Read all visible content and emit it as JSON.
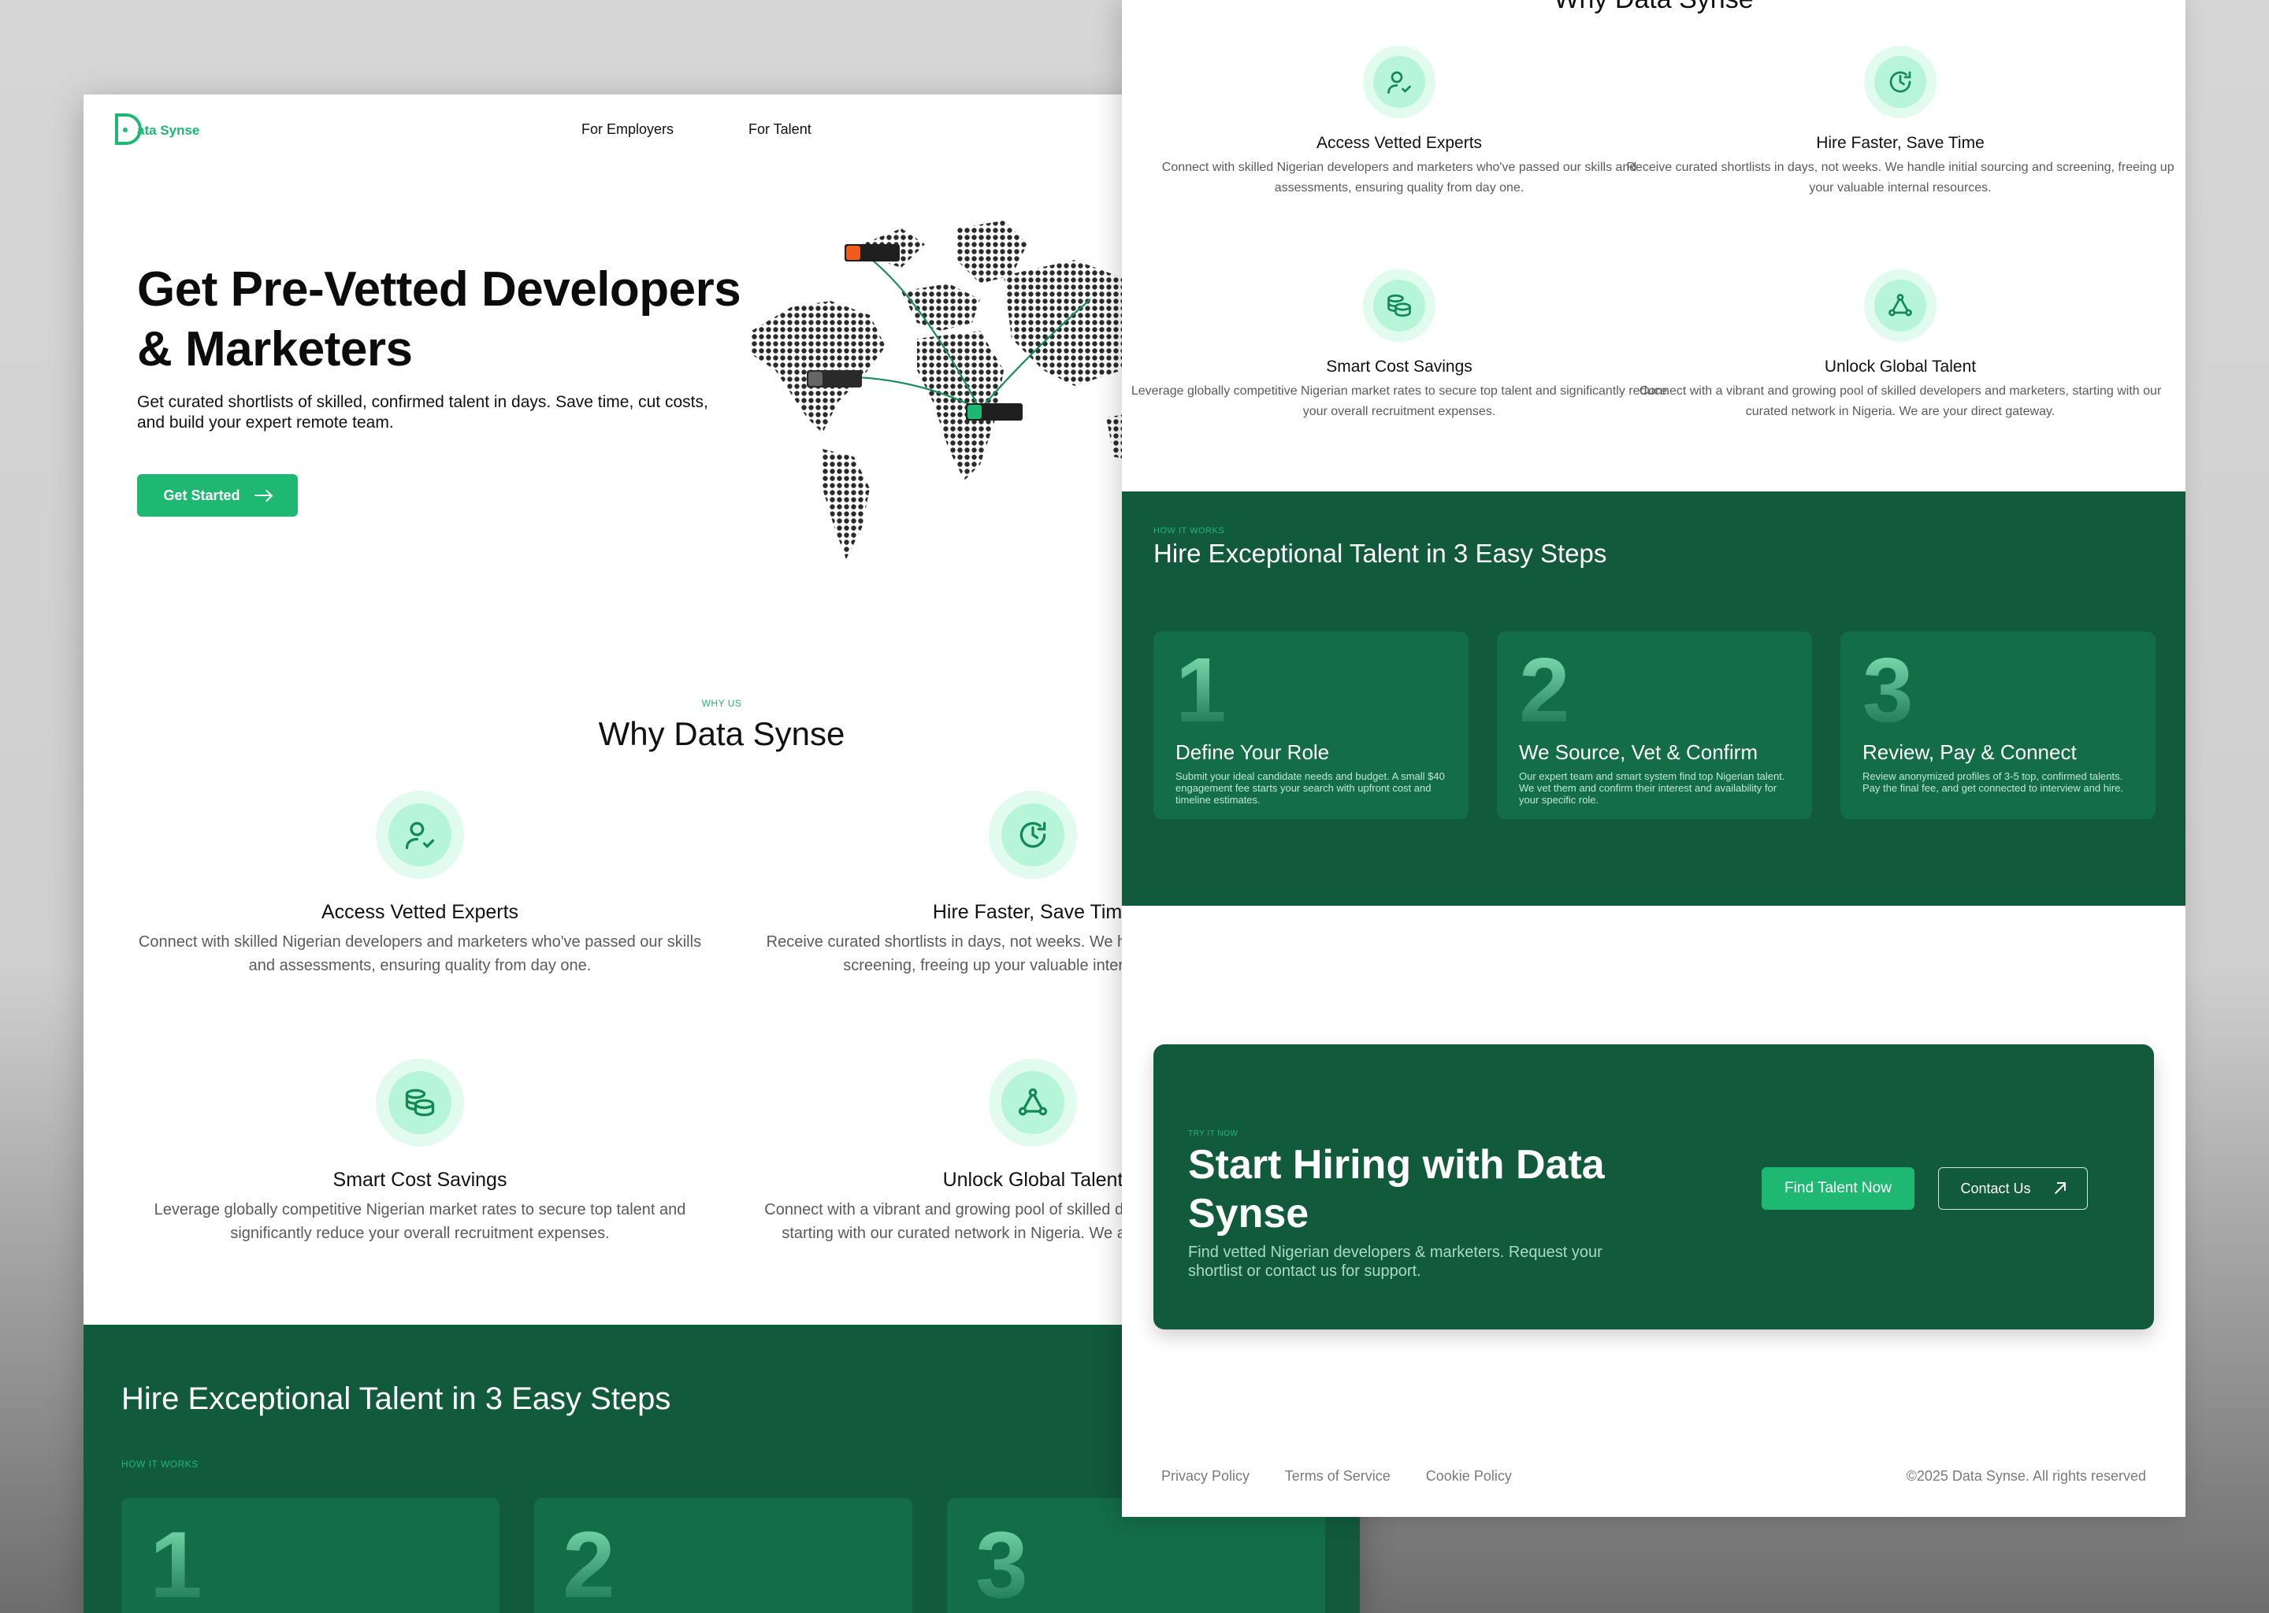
{
  "brand": {
    "name": "ata Synse",
    "logo_letter": "D"
  },
  "nav": {
    "for_employers": "For Employers",
    "for_talent": "For Talent"
  },
  "hero": {
    "title": "Get Pre-Vetted Developers & Marketers",
    "subtitle": "Get curated shortlists of skilled, confirmed talent in days. Save time, cut costs, and build your expert remote team.",
    "cta_label": "Get Started"
  },
  "why": {
    "eyebrow": "WHY US",
    "title": "Why Data Synse",
    "features": [
      {
        "icon": "user-check-icon",
        "title": "Access Vetted Experts",
        "text": "Connect with skilled Nigerian developers and marketers who've passed our skills and assessments, ensuring quality from day one."
      },
      {
        "icon": "clock-refresh-icon",
        "title": "Hire Faster, Save Time",
        "text": "Receive curated shortlists in days, not weeks. We handle initial sourcing and screening, freeing up your valuable internal resources."
      },
      {
        "icon": "coins-stack-icon",
        "title": "Smart Cost Savings",
        "text": "Leverage globally competitive Nigerian market rates to secure top talent and significantly reduce your overall recruitment expenses."
      },
      {
        "icon": "network-icon",
        "title": "Unlock Global Talent",
        "text": "Connect with a vibrant and growing pool of skilled developers and marketers, starting with our curated network in Nigeria. We are your direct gateway."
      }
    ]
  },
  "how": {
    "eyebrow": "HOW IT WORKS",
    "title": "Hire Exceptional Talent in 3 Easy Steps",
    "steps": [
      {
        "num": "1",
        "title": "Define Your Role",
        "text": "Submit your ideal candidate needs and budget. A small $40 engagement fee starts your search with upfront cost and timeline estimates."
      },
      {
        "num": "2",
        "title": "We Source, Vet & Confirm",
        "text": "Our expert team and smart system find top Nigerian talent. We vet them and confirm their interest and availability for your specific role."
      },
      {
        "num": "3",
        "title": "Review, Pay & Connect",
        "text": "Review anonymized profiles of 3-5 top, confirmed talents. Pay the final fee, and get connected to interview and hire."
      }
    ]
  },
  "cta": {
    "eyebrow": "TRY IT NOW",
    "title": "Start Hiring with Data Synse",
    "subtitle": "Find vetted Nigerian developers & marketers. Request your shortlist or contact us for support.",
    "primary": "Find Talent Now",
    "secondary": "Contact Us"
  },
  "footer": {
    "privacy": "Privacy Policy",
    "terms": "Terms of Service",
    "cookies": "Cookie Policy",
    "copyright": "©2025 Data Synse. All rights reserved"
  },
  "colors": {
    "accent": "#1fb872",
    "dark_green": "#125a3c",
    "card_green": "#136d47",
    "mint": "#e1fbef"
  }
}
